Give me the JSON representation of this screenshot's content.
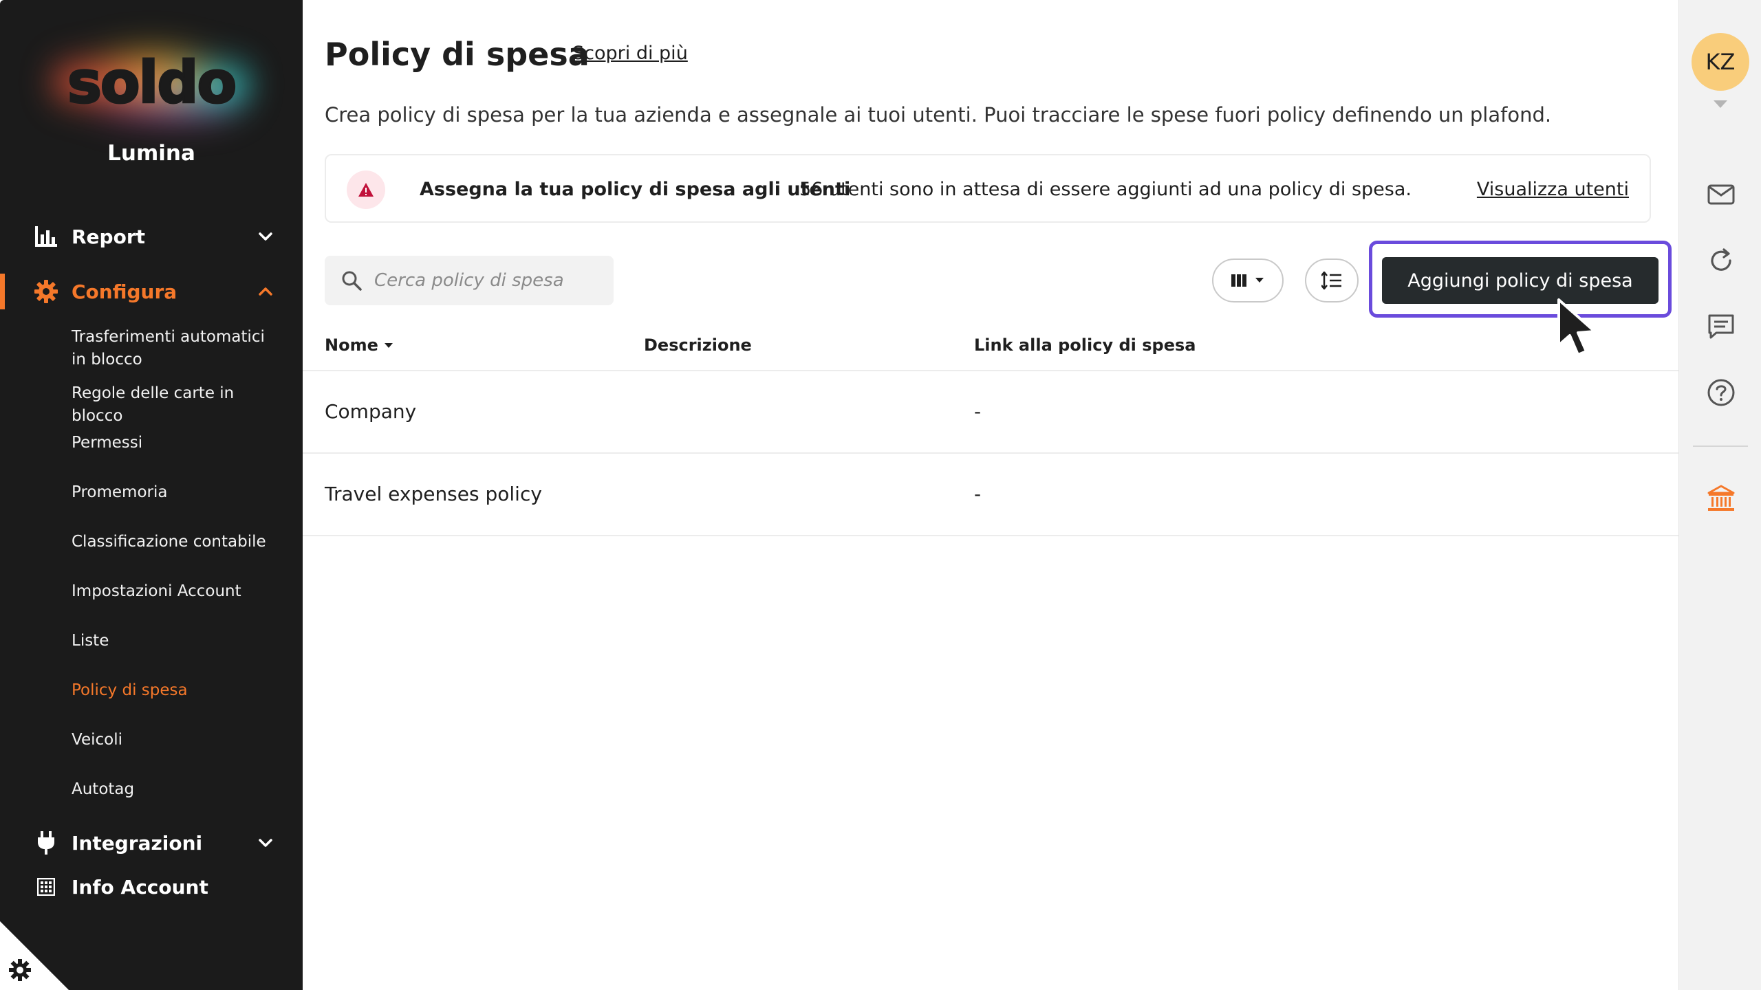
{
  "sidebar": {
    "logo_text": "soldo",
    "org_name": "Lumina",
    "sections": {
      "report": "Report",
      "configura": "Configura",
      "integrazioni": "Integrazioni",
      "info_account": "Info Account"
    },
    "configura_items": [
      "Trasferimenti automatici in blocco",
      "Regole delle carte in blocco",
      "Permessi",
      "Promemoria",
      "Classificazione contabile",
      "Impostazioni Account",
      "Liste",
      "Policy di spesa",
      "Veicoli",
      "Autotag"
    ],
    "active_item": "Policy di spesa",
    "accent_color": "#f5782a"
  },
  "header": {
    "title": "Policy di spesa",
    "learn_more": "Scopri di più",
    "subtitle": "Crea policy di spesa per la tua azienda e assegnale ai tuoi utenti. Puoi tracciare le spese fuori policy definendo un plafond."
  },
  "banner": {
    "icon": "warning-triangle-icon",
    "title": "Assegna la tua policy di spesa agli utenti",
    "text": "56 utenti sono in attesa di essere aggiunti ad una policy di spesa.",
    "link": "Visualizza utenti"
  },
  "toolbar": {
    "search_placeholder": "Cerca policy di spesa",
    "add_button": "Aggiungi policy di spesa",
    "highlight_color": "#6a4bdc"
  },
  "table": {
    "columns": [
      "Nome",
      "Descrizione",
      "Link alla policy di spesa"
    ],
    "rows": [
      {
        "name": "Company",
        "description": "",
        "link": "-"
      },
      {
        "name": "Travel expenses policy",
        "description": "",
        "link": "-"
      }
    ]
  },
  "rail": {
    "avatar_initials": "KZ",
    "icons": [
      "mail-icon",
      "refresh-icon",
      "chat-icon",
      "help-icon",
      "bank-icon"
    ]
  }
}
